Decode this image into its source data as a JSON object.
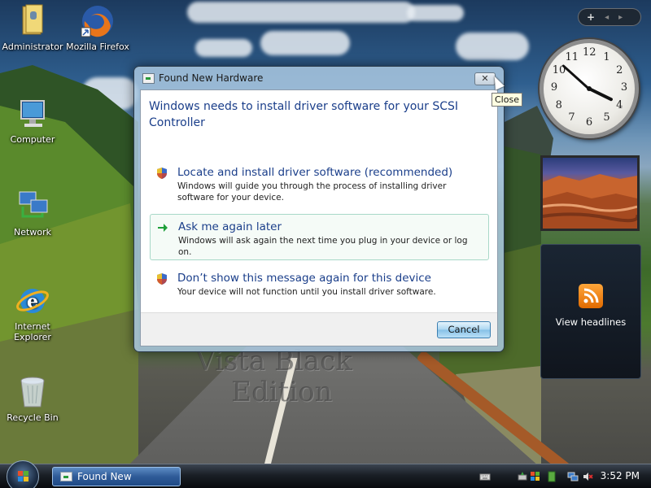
{
  "desktop": {
    "icons": [
      {
        "label": "Administrator"
      },
      {
        "label": "Mozilla Firefox"
      },
      {
        "label": "Computer"
      },
      {
        "label": "Network"
      },
      {
        "label": "Internet Explorer"
      },
      {
        "label": "Recycle Bin"
      }
    ],
    "watermark_line1": "Vista Black",
    "watermark_line2": "Edition"
  },
  "sidebar": {
    "toolbar": {
      "add": "+",
      "prev": "◂",
      "next": "▸"
    },
    "clock": {
      "numbers": [
        "12",
        "1",
        "2",
        "3",
        "4",
        "5",
        "6",
        "7",
        "8",
        "9",
        "10",
        "11"
      ],
      "hour": 3,
      "minute": 52
    },
    "feeds": {
      "label": "View headlines"
    }
  },
  "dialog": {
    "title": "Found New Hardware",
    "close_glyph": "✕",
    "tooltip": "Close",
    "heading": "Windows needs to install driver software for your SCSI Controller",
    "options": [
      {
        "title": "Locate and install driver software (recommended)",
        "desc": "Windows will guide you through the process of installing driver software for your device.",
        "icon": "shield-icon"
      },
      {
        "title": "Ask me again later",
        "desc": "Windows will ask again the next time you plug in your device or log on.",
        "icon": "green-arrow-icon"
      },
      {
        "title": "Don’t show this message again for this device",
        "desc": "Your device will not function until you install driver software.",
        "icon": "shield-icon"
      }
    ],
    "cancel_label": "Cancel"
  },
  "taskbar": {
    "task_button": "Found New Hardware",
    "time": "3:52 PM"
  },
  "colors": {
    "heading": "#1a3e8a",
    "taskbar": "#1a1f26",
    "selected_option_border": "#a8d8c8"
  }
}
